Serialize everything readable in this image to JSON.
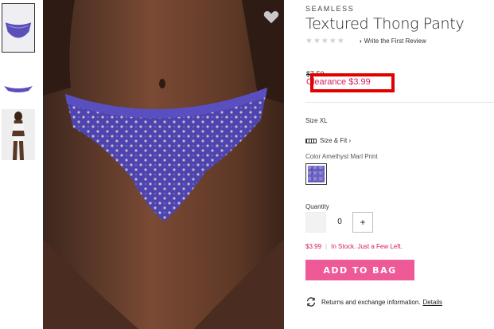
{
  "product": {
    "brand": "SEAMLESS",
    "title": "Textured Thong Panty",
    "rating_stars": "★★★★★",
    "review_link": "Write the First Review",
    "original_price": "$7.50",
    "sale_price": "Clearance $3.99"
  },
  "options": {
    "size_label": "Size",
    "size_value": "XL",
    "size_fit_link": "Size & Fit",
    "color_label": "Color",
    "color_value": "Amethyst Marl Print",
    "swatch_color": "#6f66c4"
  },
  "quantity": {
    "label": "Quantity",
    "value": "0",
    "plus": "+"
  },
  "stock": {
    "price": "$3.99",
    "status": "In Stock. Just a Few Left."
  },
  "actions": {
    "add_to_bag": "ADD TO BAG"
  },
  "returns": {
    "text": "Returns and exchange information.",
    "link": "Details"
  },
  "colors": {
    "accent_pink": "#ee5a97",
    "sale_red": "#d21c5c",
    "highlight_red": "#e10000"
  },
  "icons": [
    "heart-icon",
    "star-icon",
    "chevron-right-icon",
    "ruler-icon",
    "returns-icon"
  ]
}
